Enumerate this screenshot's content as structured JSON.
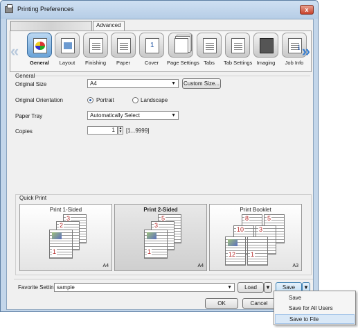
{
  "window": {
    "title": "Printing Preferences",
    "close_label": "x"
  },
  "tabs": {
    "advanced": "Advanced"
  },
  "iconbar": {
    "left_arrow": "«",
    "right_arrow": "»",
    "items": [
      {
        "label": "General",
        "icon": "general-icon"
      },
      {
        "label": "Layout",
        "icon": "layout-icon"
      },
      {
        "label": "Finishing",
        "icon": "finishing-icon"
      },
      {
        "label": "Paper",
        "icon": "paper-icon"
      },
      {
        "label": "Cover",
        "icon": "cover-icon"
      },
      {
        "label": "Page Settings",
        "icon": "page-settings-icon"
      },
      {
        "label": "Tabs",
        "icon": "tabs-icon"
      },
      {
        "label": "Tab Settings",
        "icon": "tab-settings-icon"
      },
      {
        "label": "Imaging",
        "icon": "imaging-icon"
      },
      {
        "label": "Job Info",
        "icon": "job-info-icon"
      }
    ]
  },
  "general": {
    "section_label": "General",
    "original_size_label": "Original Size",
    "original_size_value": "A4",
    "custom_size_button": "Custom Size...",
    "orientation_label": "Original Orientation",
    "portrait": "Portrait",
    "landscape": "Landscape",
    "paper_tray_label": "Paper Tray",
    "paper_tray_value": "Automatically Select",
    "copies_label": "Copies",
    "copies_value": "1",
    "copies_range": "[1...9999]"
  },
  "quick_print": {
    "label": "Quick Print",
    "cards": [
      {
        "title": "Print 1-Sided",
        "size": "A4",
        "pages": [
          "3",
          "2",
          "1"
        ]
      },
      {
        "title": "Print 2-Sided",
        "size": "A4",
        "pages": [
          "5",
          "3",
          "1"
        ]
      },
      {
        "title": "Print Booklet",
        "size": "A3",
        "pages": [
          "8",
          "5",
          "10",
          "3",
          "12",
          "1"
        ]
      }
    ]
  },
  "footer": {
    "favorite_label": "Favorite Setting",
    "favorite_value": "sample",
    "load_button": "Load",
    "save_button": "Save",
    "ok_button": "OK",
    "cancel_button": "Cancel"
  },
  "save_menu": {
    "items": [
      "Save",
      "Save for All Users",
      "Save to File"
    ],
    "highlighted": "Save to File"
  }
}
